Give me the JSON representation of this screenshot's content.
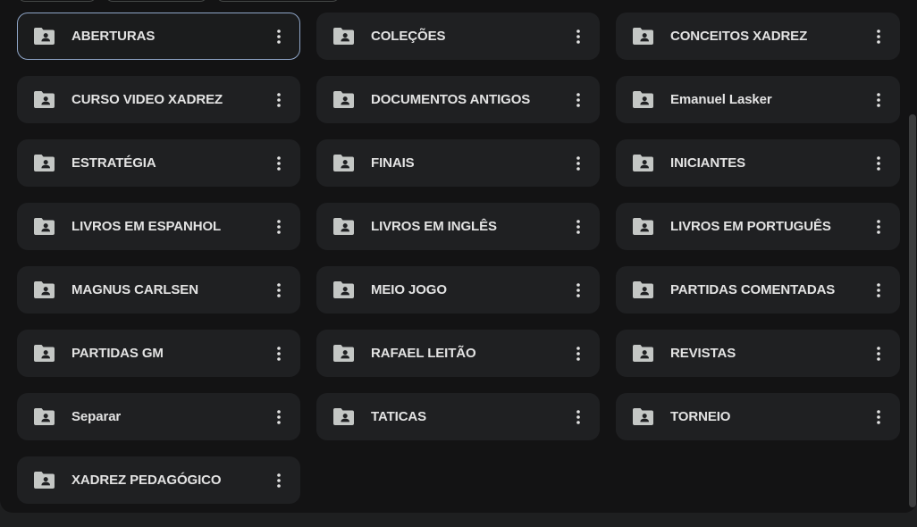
{
  "folders": [
    {
      "name": "ABERTURAS",
      "selected": true
    },
    {
      "name": "COLEÇÕES"
    },
    {
      "name": "CONCEITOS XADREZ"
    },
    {
      "name": "CURSO VIDEO XADREZ"
    },
    {
      "name": "DOCUMENTOS ANTIGOS"
    },
    {
      "name": "Emanuel Lasker"
    },
    {
      "name": "ESTRATÉGIA"
    },
    {
      "name": "FINAIS"
    },
    {
      "name": "INICIANTES"
    },
    {
      "name": "LIVROS EM ESPANHOL"
    },
    {
      "name": "LIVROS EM INGLÊS"
    },
    {
      "name": "LIVROS EM PORTUGUÊS"
    },
    {
      "name": "MAGNUS CARLSEN"
    },
    {
      "name": "MEIO JOGO"
    },
    {
      "name": "PARTIDAS COMENTADAS"
    },
    {
      "name": "PARTIDAS GM"
    },
    {
      "name": "RAFAEL LEITÃO"
    },
    {
      "name": "REVISTAS"
    },
    {
      "name": "Separar"
    },
    {
      "name": "TATICAS"
    },
    {
      "name": "TORNEIO"
    },
    {
      "name": "XADREZ PEDAGÓGICO"
    }
  ],
  "icons": {
    "folder": "shared-folder-icon",
    "more": "more-vertical-icon"
  },
  "colors": {
    "background": "#131314",
    "card": "#1f2022",
    "text": "#e3e3e3",
    "icon": "#c4c7c5",
    "selected_border": "#8fa6c8"
  }
}
